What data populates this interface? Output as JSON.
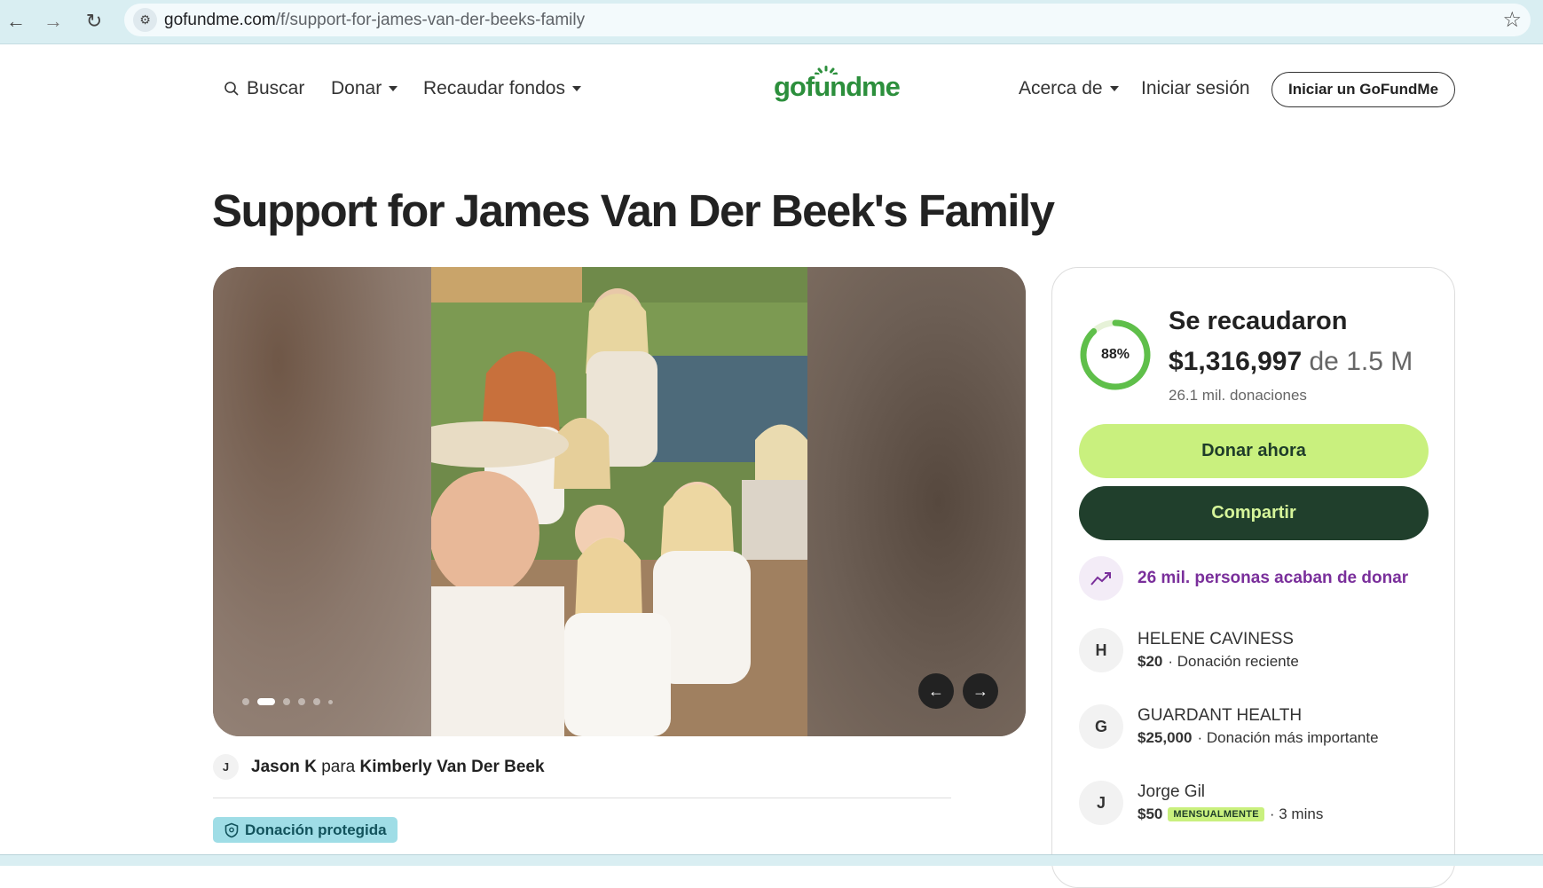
{
  "browser": {
    "url_domain": "gofundme.com",
    "url_path": "/f/support-for-james-van-der-beeks-family"
  },
  "header": {
    "search_label": "Buscar",
    "donate_label": "Donar",
    "fundraise_label": "Recaudar fondos",
    "logo_text": "gofundme",
    "about_label": "Acerca de",
    "signin_label": "Iniciar sesión",
    "start_label": "Iniciar un GoFundMe"
  },
  "campaign": {
    "title": "Support for James Van Der Beek's Family",
    "organizer_initial": "J",
    "organizer_name": "Jason K",
    "organizer_for": "para",
    "beneficiary": "Kimberly Van Der Beek",
    "protected_label": "Donación protegida",
    "carousel_active_index": 1,
    "carousel_count": 6
  },
  "progress": {
    "percent_label": "88%",
    "percent_value": 0.88,
    "raised_label": "Se recaudaron",
    "raised_amount": "$1,316,997",
    "goal_text": "de 1.5 M",
    "donations_count": "26.1 mil. donaciones",
    "donate_button": "Donar ahora",
    "share_button": "Compartir",
    "trend_text": "26 mil. personas acaban de donar"
  },
  "donors": [
    {
      "initial": "H",
      "name": "HELENE CAVINESS",
      "amount": "$20",
      "note": "· Donación reciente",
      "badge": ""
    },
    {
      "initial": "G",
      "name": "GUARDANT HEALTH",
      "amount": "$25,000",
      "note": "· Donación más importante",
      "badge": ""
    },
    {
      "initial": "J",
      "name": "Jorge Gil",
      "amount": "$50",
      "note": "· 3 mins",
      "badge": "MENSUALMENTE"
    }
  ],
  "colors": {
    "brand_green": "#2c8f3c",
    "donate_button": "#c9f07e",
    "share_button": "#203f2c",
    "trend_purple": "#7a2f9b",
    "protected_badge": "#9fdde6"
  }
}
